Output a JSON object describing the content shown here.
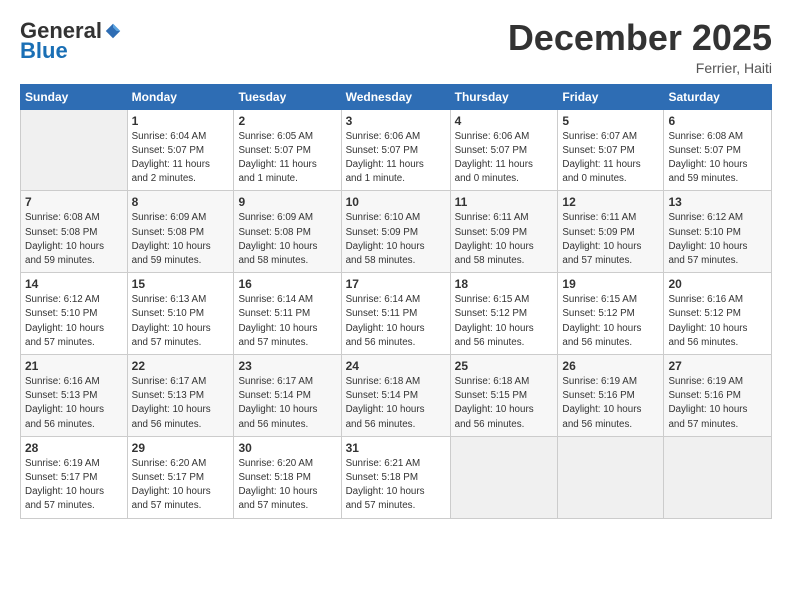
{
  "logo": {
    "general": "General",
    "blue": "Blue"
  },
  "header": {
    "month": "December 2025",
    "location": "Ferrier, Haiti"
  },
  "weekdays": [
    "Sunday",
    "Monday",
    "Tuesday",
    "Wednesday",
    "Thursday",
    "Friday",
    "Saturday"
  ],
  "weeks": [
    [
      {
        "day": "",
        "info": ""
      },
      {
        "day": "1",
        "info": "Sunrise: 6:04 AM\nSunset: 5:07 PM\nDaylight: 11 hours\nand 2 minutes."
      },
      {
        "day": "2",
        "info": "Sunrise: 6:05 AM\nSunset: 5:07 PM\nDaylight: 11 hours\nand 1 minute."
      },
      {
        "day": "3",
        "info": "Sunrise: 6:06 AM\nSunset: 5:07 PM\nDaylight: 11 hours\nand 1 minute."
      },
      {
        "day": "4",
        "info": "Sunrise: 6:06 AM\nSunset: 5:07 PM\nDaylight: 11 hours\nand 0 minutes."
      },
      {
        "day": "5",
        "info": "Sunrise: 6:07 AM\nSunset: 5:07 PM\nDaylight: 11 hours\nand 0 minutes."
      },
      {
        "day": "6",
        "info": "Sunrise: 6:08 AM\nSunset: 5:07 PM\nDaylight: 10 hours\nand 59 minutes."
      }
    ],
    [
      {
        "day": "7",
        "info": "Sunrise: 6:08 AM\nSunset: 5:08 PM\nDaylight: 10 hours\nand 59 minutes."
      },
      {
        "day": "8",
        "info": "Sunrise: 6:09 AM\nSunset: 5:08 PM\nDaylight: 10 hours\nand 59 minutes."
      },
      {
        "day": "9",
        "info": "Sunrise: 6:09 AM\nSunset: 5:08 PM\nDaylight: 10 hours\nand 58 minutes."
      },
      {
        "day": "10",
        "info": "Sunrise: 6:10 AM\nSunset: 5:09 PM\nDaylight: 10 hours\nand 58 minutes."
      },
      {
        "day": "11",
        "info": "Sunrise: 6:11 AM\nSunset: 5:09 PM\nDaylight: 10 hours\nand 58 minutes."
      },
      {
        "day": "12",
        "info": "Sunrise: 6:11 AM\nSunset: 5:09 PM\nDaylight: 10 hours\nand 57 minutes."
      },
      {
        "day": "13",
        "info": "Sunrise: 6:12 AM\nSunset: 5:10 PM\nDaylight: 10 hours\nand 57 minutes."
      }
    ],
    [
      {
        "day": "14",
        "info": "Sunrise: 6:12 AM\nSunset: 5:10 PM\nDaylight: 10 hours\nand 57 minutes."
      },
      {
        "day": "15",
        "info": "Sunrise: 6:13 AM\nSunset: 5:10 PM\nDaylight: 10 hours\nand 57 minutes."
      },
      {
        "day": "16",
        "info": "Sunrise: 6:14 AM\nSunset: 5:11 PM\nDaylight: 10 hours\nand 57 minutes."
      },
      {
        "day": "17",
        "info": "Sunrise: 6:14 AM\nSunset: 5:11 PM\nDaylight: 10 hours\nand 56 minutes."
      },
      {
        "day": "18",
        "info": "Sunrise: 6:15 AM\nSunset: 5:12 PM\nDaylight: 10 hours\nand 56 minutes."
      },
      {
        "day": "19",
        "info": "Sunrise: 6:15 AM\nSunset: 5:12 PM\nDaylight: 10 hours\nand 56 minutes."
      },
      {
        "day": "20",
        "info": "Sunrise: 6:16 AM\nSunset: 5:12 PM\nDaylight: 10 hours\nand 56 minutes."
      }
    ],
    [
      {
        "day": "21",
        "info": "Sunrise: 6:16 AM\nSunset: 5:13 PM\nDaylight: 10 hours\nand 56 minutes."
      },
      {
        "day": "22",
        "info": "Sunrise: 6:17 AM\nSunset: 5:13 PM\nDaylight: 10 hours\nand 56 minutes."
      },
      {
        "day": "23",
        "info": "Sunrise: 6:17 AM\nSunset: 5:14 PM\nDaylight: 10 hours\nand 56 minutes."
      },
      {
        "day": "24",
        "info": "Sunrise: 6:18 AM\nSunset: 5:14 PM\nDaylight: 10 hours\nand 56 minutes."
      },
      {
        "day": "25",
        "info": "Sunrise: 6:18 AM\nSunset: 5:15 PM\nDaylight: 10 hours\nand 56 minutes."
      },
      {
        "day": "26",
        "info": "Sunrise: 6:19 AM\nSunset: 5:16 PM\nDaylight: 10 hours\nand 56 minutes."
      },
      {
        "day": "27",
        "info": "Sunrise: 6:19 AM\nSunset: 5:16 PM\nDaylight: 10 hours\nand 57 minutes."
      }
    ],
    [
      {
        "day": "28",
        "info": "Sunrise: 6:19 AM\nSunset: 5:17 PM\nDaylight: 10 hours\nand 57 minutes."
      },
      {
        "day": "29",
        "info": "Sunrise: 6:20 AM\nSunset: 5:17 PM\nDaylight: 10 hours\nand 57 minutes."
      },
      {
        "day": "30",
        "info": "Sunrise: 6:20 AM\nSunset: 5:18 PM\nDaylight: 10 hours\nand 57 minutes."
      },
      {
        "day": "31",
        "info": "Sunrise: 6:21 AM\nSunset: 5:18 PM\nDaylight: 10 hours\nand 57 minutes."
      },
      {
        "day": "",
        "info": ""
      },
      {
        "day": "",
        "info": ""
      },
      {
        "day": "",
        "info": ""
      }
    ]
  ]
}
